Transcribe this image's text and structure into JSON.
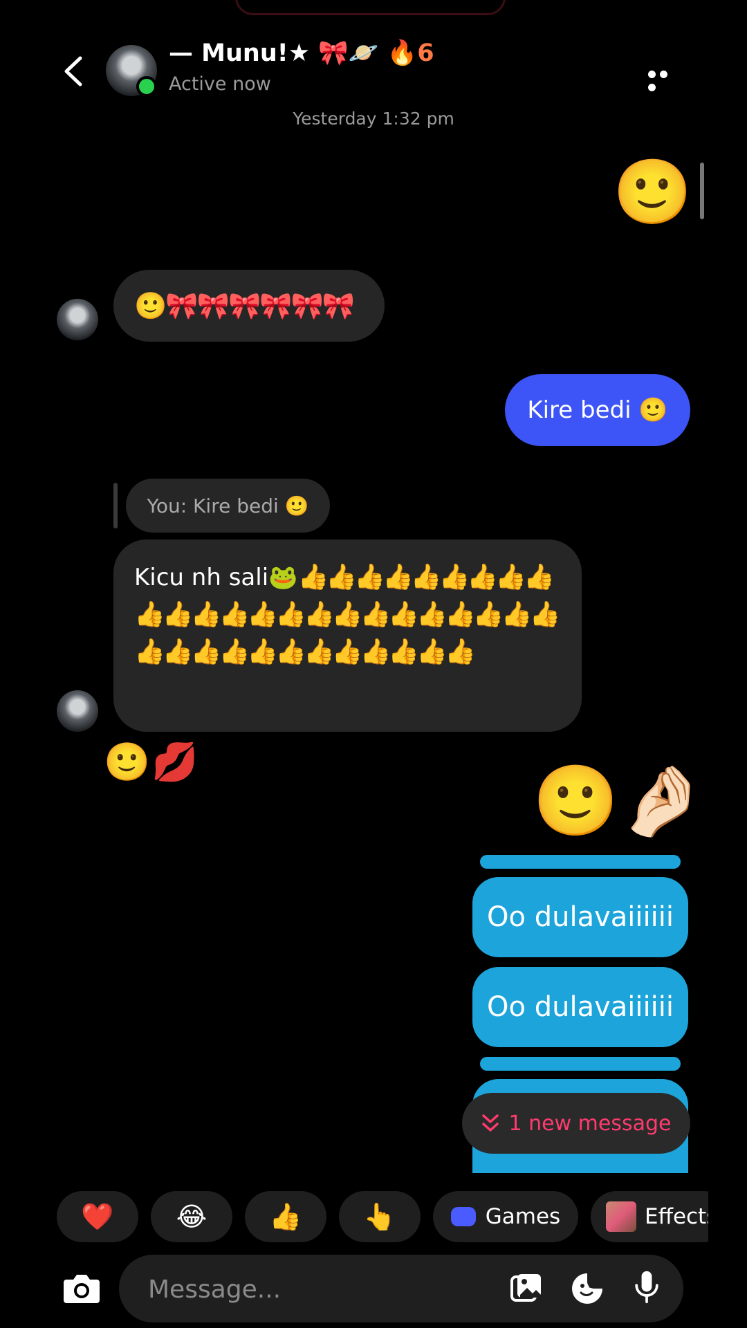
{
  "header": {
    "contact_name": "— Munu!★ 🎀🪐",
    "streak_emoji": "🔥",
    "streak_count": "6",
    "status": "Active now"
  },
  "timestamp": "Yesterday 1:32 pm",
  "messages": {
    "sent_emoji": "🙂",
    "received_1": "🙂🎀🎀🎀🎀🎀🎀",
    "sent_1": "Kire bedi 🙂",
    "reply_preview": "You: Kire bedi 🙂",
    "received_2_text": "Kicu nh sali🐸",
    "received_2_emojis": "👍👍👍👍👍👍👍👍👍👍👍👍👍👍👍👍👍👍👍👍👍👍👍👍👍👍👍👍👍👍👍👍👍👍👍👍",
    "received_reaction": "🙂💋",
    "sent_2": "🙂🤌🏻",
    "sent_3": "Oo dulavaiiiiii",
    "sent_4": "Oo dulavaiiiiii"
  },
  "new_message_pill": "1 new message",
  "quick_reactions": {
    "heart": "❤️",
    "laugh": "😂",
    "thumbs": "👍",
    "point": "👆",
    "games_label": "Games",
    "effects_label": "Effects"
  },
  "composer": {
    "placeholder": "Message..."
  }
}
